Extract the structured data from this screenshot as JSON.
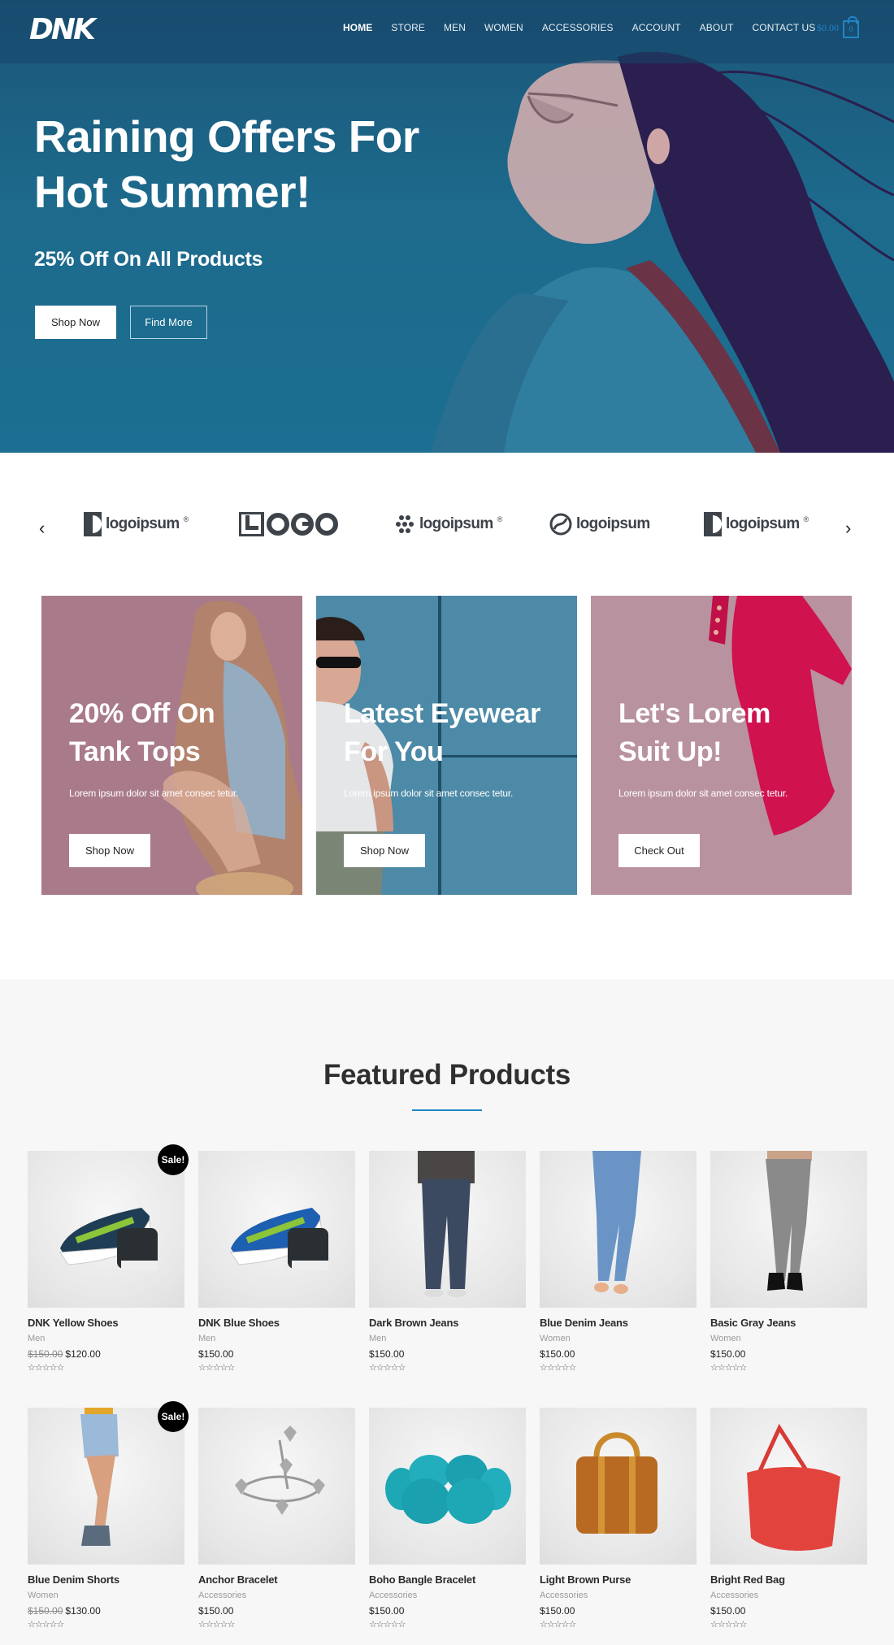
{
  "header": {
    "logo_text": "DNK",
    "nav": [
      {
        "label": "HOME",
        "active": true
      },
      {
        "label": "STORE"
      },
      {
        "label": "MEN"
      },
      {
        "label": "WOMEN"
      },
      {
        "label": "ACCESSORIES"
      },
      {
        "label": "ACCOUNT"
      },
      {
        "label": "ABOUT"
      },
      {
        "label": "CONTACT US"
      }
    ],
    "cart": {
      "amount": "$0.00",
      "count": "0"
    }
  },
  "hero": {
    "title_line1": "Raining Offers For",
    "title_line2": "Hot Summer!",
    "subtitle": "25% Off On All Products",
    "shop_label": "Shop Now",
    "find_label": "Find More"
  },
  "logos": {
    "items": [
      {
        "text": "logoipsum",
        "mark": "half-circle-icon"
      },
      {
        "text": "LOGO",
        "mark": "square-l-icon"
      },
      {
        "text": "logoipsum",
        "mark": "dots-icon"
      },
      {
        "text": "logoipsum",
        "mark": "striped-circle-icon"
      },
      {
        "text": "logoipsum",
        "mark": "half-circle-icon"
      }
    ],
    "prev": "‹",
    "next": "›"
  },
  "promos": [
    {
      "title_line1": "20% Off On",
      "title_line2": "Tank Tops",
      "desc": "Lorem ipsum dolor sit amet consec tetur.",
      "button": "Shop Now"
    },
    {
      "title_line1": "Latest Eyewear",
      "title_line2": "For You",
      "desc": "Lorem ipsum dolor sit amet consec tetur.",
      "button": "Shop Now"
    },
    {
      "title_line1": "Let's Lorem",
      "title_line2": "Suit Up!",
      "desc": "Lorem ipsum dolor sit amet consec tetur.",
      "button": "Check Out"
    }
  ],
  "featured": {
    "title": "Featured Products",
    "sale_label": "Sale!",
    "stars": "☆☆☆☆☆",
    "products": [
      {
        "name": "DNK Yellow Shoes",
        "category": "Men",
        "old_price": "$150.00",
        "price": "$120.00",
        "sale": true
      },
      {
        "name": "DNK Blue Shoes",
        "category": "Men",
        "old_price": "",
        "price": "$150.00",
        "sale": false
      },
      {
        "name": "Dark Brown Jeans",
        "category": "Men",
        "old_price": "",
        "price": "$150.00",
        "sale": false
      },
      {
        "name": "Blue Denim Jeans",
        "category": "Women",
        "old_price": "",
        "price": "$150.00",
        "sale": false
      },
      {
        "name": "Basic Gray Jeans",
        "category": "Women",
        "old_price": "",
        "price": "$150.00",
        "sale": false
      },
      {
        "name": "Blue Denim Shorts",
        "category": "Women",
        "old_price": "$150.00",
        "price": "$130.00",
        "sale": true
      },
      {
        "name": "Anchor Bracelet",
        "category": "Accessories",
        "old_price": "",
        "price": "$150.00",
        "sale": false
      },
      {
        "name": "Boho Bangle Bracelet",
        "category": "Accessories",
        "old_price": "",
        "price": "$150.00",
        "sale": false
      },
      {
        "name": "Light Brown Purse",
        "category": "Accessories",
        "old_price": "",
        "price": "$150.00",
        "sale": false
      },
      {
        "name": "Bright Red Bag",
        "category": "Accessories",
        "old_price": "",
        "price": "$150.00",
        "sale": false
      }
    ]
  },
  "colors": {
    "accent": "#1f86c7",
    "hero_bg": "#1d6a8c",
    "promo1": "#a97a89",
    "promo2": "#4c8aa7",
    "promo3": "#b9929f",
    "featured_bg": "#f7f7f7"
  }
}
